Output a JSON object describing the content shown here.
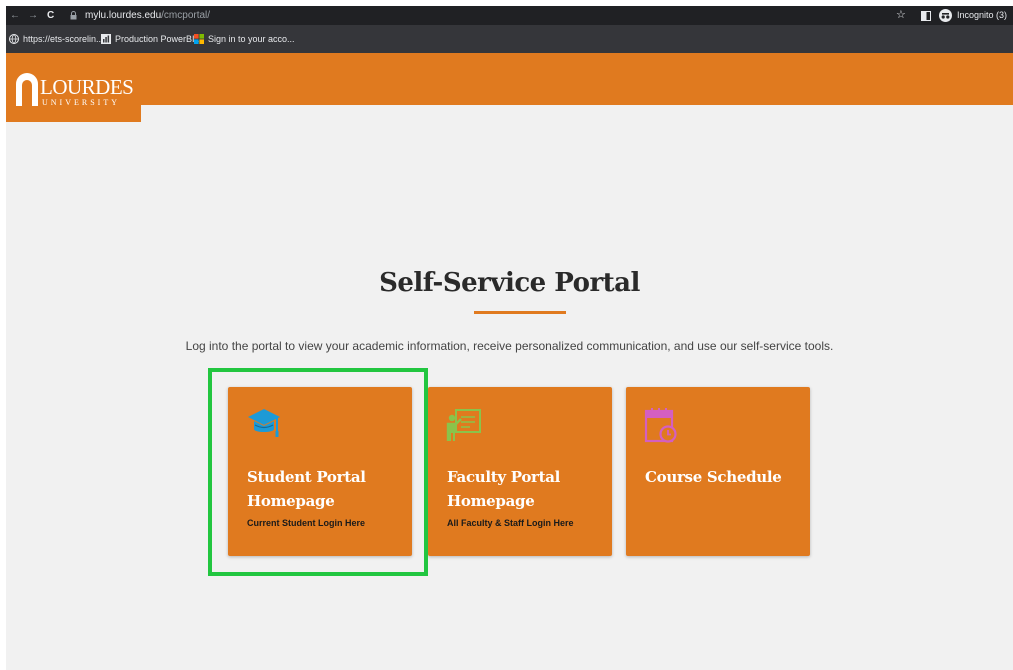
{
  "browser": {
    "url_host": "mylu.lourdes.edu",
    "url_path": "/cmcportal/",
    "incognito_label": "Incognito (3)",
    "back_glyph": "←",
    "forward_glyph": "→",
    "reload_glyph": "C",
    "star_glyph": "☆",
    "bookmarks": [
      {
        "label": "https://ets-scorelin...",
        "icon": "globe-icon"
      },
      {
        "label": "Production PowerBI...",
        "icon": "powerbi-icon"
      },
      {
        "label": "Sign in to your acco...",
        "icon": "microsoft-icon"
      }
    ]
  },
  "site": {
    "logo_name": "LOURDES",
    "logo_sub": "UNIVERSITY",
    "brand_color": "#e07a1f"
  },
  "main": {
    "title": "Self-Service Portal",
    "subtitle": "Log into the portal to view your academic information, receive personalized communication, and use our self-service tools.",
    "cards": [
      {
        "title": "Student Portal Homepage",
        "subtitle": "Current Student Login Here",
        "icon": "graduation-cap-icon",
        "icon_color": "#1d9ad6"
      },
      {
        "title": "Faculty Portal Homepage",
        "subtitle": "All Faculty & Staff Login Here",
        "icon": "teacher-board-icon",
        "icon_color": "#8bc34a"
      },
      {
        "title": "Course Schedule",
        "subtitle": "",
        "icon": "calendar-clock-icon",
        "icon_color": "#d45fc0"
      }
    ]
  },
  "highlight_color": "#22c640"
}
